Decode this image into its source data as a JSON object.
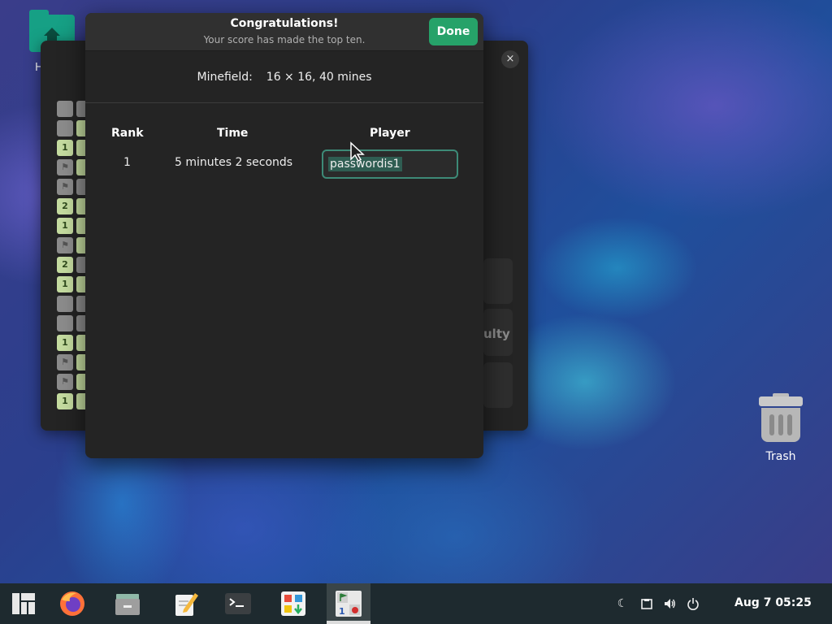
{
  "desktop": {
    "home_label": "H",
    "trash_label": "Trash"
  },
  "background_window": {
    "close_glyph": "×",
    "difficulty_fragment": "ulty"
  },
  "dialog": {
    "title": "Congratulations!",
    "subtitle": "Your score has made the top ten.",
    "done_label": "Done",
    "minefield_label": "Minefield:",
    "minefield_value": "16 × 16, 40 mines",
    "columns": [
      "Rank",
      "Time",
      "Player"
    ],
    "rows": [
      {
        "rank": "1",
        "time": "5 minutes 2 seconds",
        "player": "passwordis1"
      }
    ]
  },
  "taskbar": {
    "apps": [
      "menu",
      "firefox",
      "files",
      "text-editor",
      "terminal",
      "software",
      "mines"
    ],
    "clock": "Aug 7  05:25"
  },
  "colors": {
    "accent": "#26a269",
    "folder": "#16a085",
    "dialog_bg": "#242424",
    "taskbar_bg": "#1e2a2f"
  }
}
